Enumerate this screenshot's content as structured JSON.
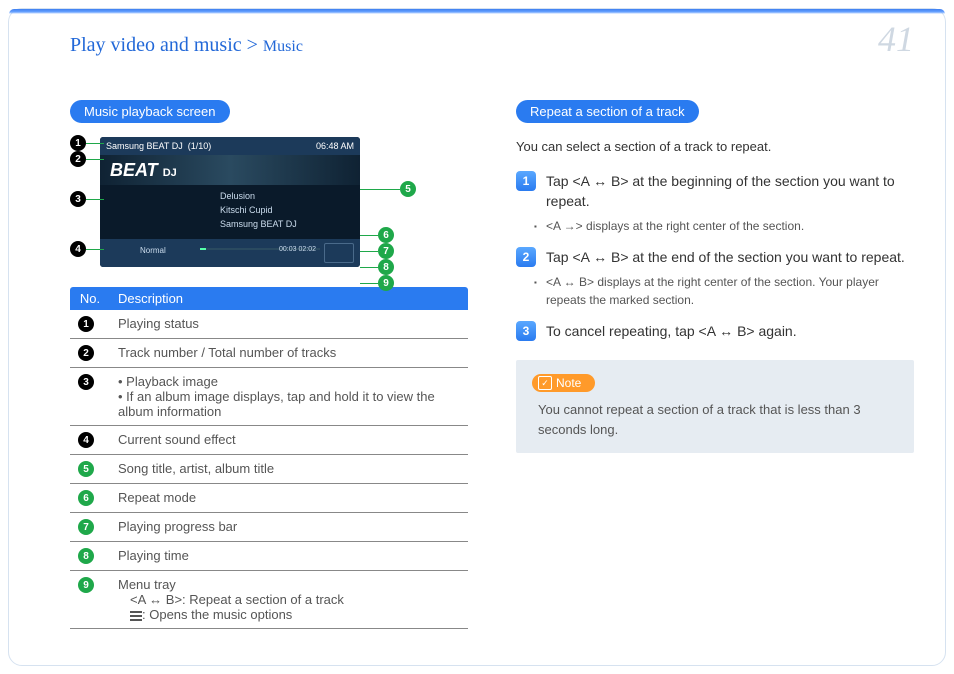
{
  "header": {
    "breadcrumb_main": "Play video and music >",
    "breadcrumb_sub": "Music",
    "page_number": "41"
  },
  "left": {
    "section_title": "Music playback screen",
    "screenshot": {
      "top_left": "Samsung BEAT DJ",
      "top_count": "(1/10)",
      "top_time": "06:48 AM",
      "brand": "BEAT",
      "brand_suffix": "DJ",
      "tracks": [
        "Delusion",
        "Kitschi Cupid",
        "Samsung BEAT DJ"
      ],
      "effect": "Normal",
      "time_elapsed": "00:03",
      "time_total": "02:02"
    },
    "table": {
      "headers": [
        "No.",
        "Description"
      ],
      "rows": [
        {
          "num": "1",
          "badge": "black",
          "desc": "Playing status"
        },
        {
          "num": "2",
          "badge": "black",
          "desc": "Track number / Total number of tracks"
        },
        {
          "num": "3",
          "badge": "black",
          "desc_list": [
            "Playback image",
            "If an album image displays, tap and hold it to view the album information"
          ]
        },
        {
          "num": "4",
          "badge": "black",
          "desc": "Current sound effect"
        },
        {
          "num": "5",
          "badge": "green",
          "desc": "Song title, artist, album title"
        },
        {
          "num": "6",
          "badge": "green",
          "desc": "Repeat mode"
        },
        {
          "num": "7",
          "badge": "green",
          "desc": "Playing progress bar"
        },
        {
          "num": "8",
          "badge": "green",
          "desc": "Playing time"
        },
        {
          "num": "9",
          "badge": "green",
          "desc_menu_title": "Menu tray",
          "desc_menu_a": "<A ↔ B>: Repeat a section of a track",
          "desc_menu_b": ": Opens the music options"
        }
      ]
    }
  },
  "right": {
    "section_title": "Repeat a section of a track",
    "intro": "You can select a section of a track to repeat.",
    "steps": [
      {
        "n": "1",
        "text": "Tap <A ↔ B> at the beginning of the section you want to repeat.",
        "sub": "<A →> displays at the right center of the section."
      },
      {
        "n": "2",
        "text": "Tap <A ↔ B> at the end of the section you want to repeat.",
        "sub": "<A ↔ B> displays at the right center of the section. Your player repeats the marked section."
      },
      {
        "n": "3",
        "text": "To cancel repeating, tap <A ↔ B> again."
      }
    ],
    "note": {
      "label": "Note",
      "text": "You cannot repeat a section of a track that is less than 3 seconds long."
    }
  }
}
